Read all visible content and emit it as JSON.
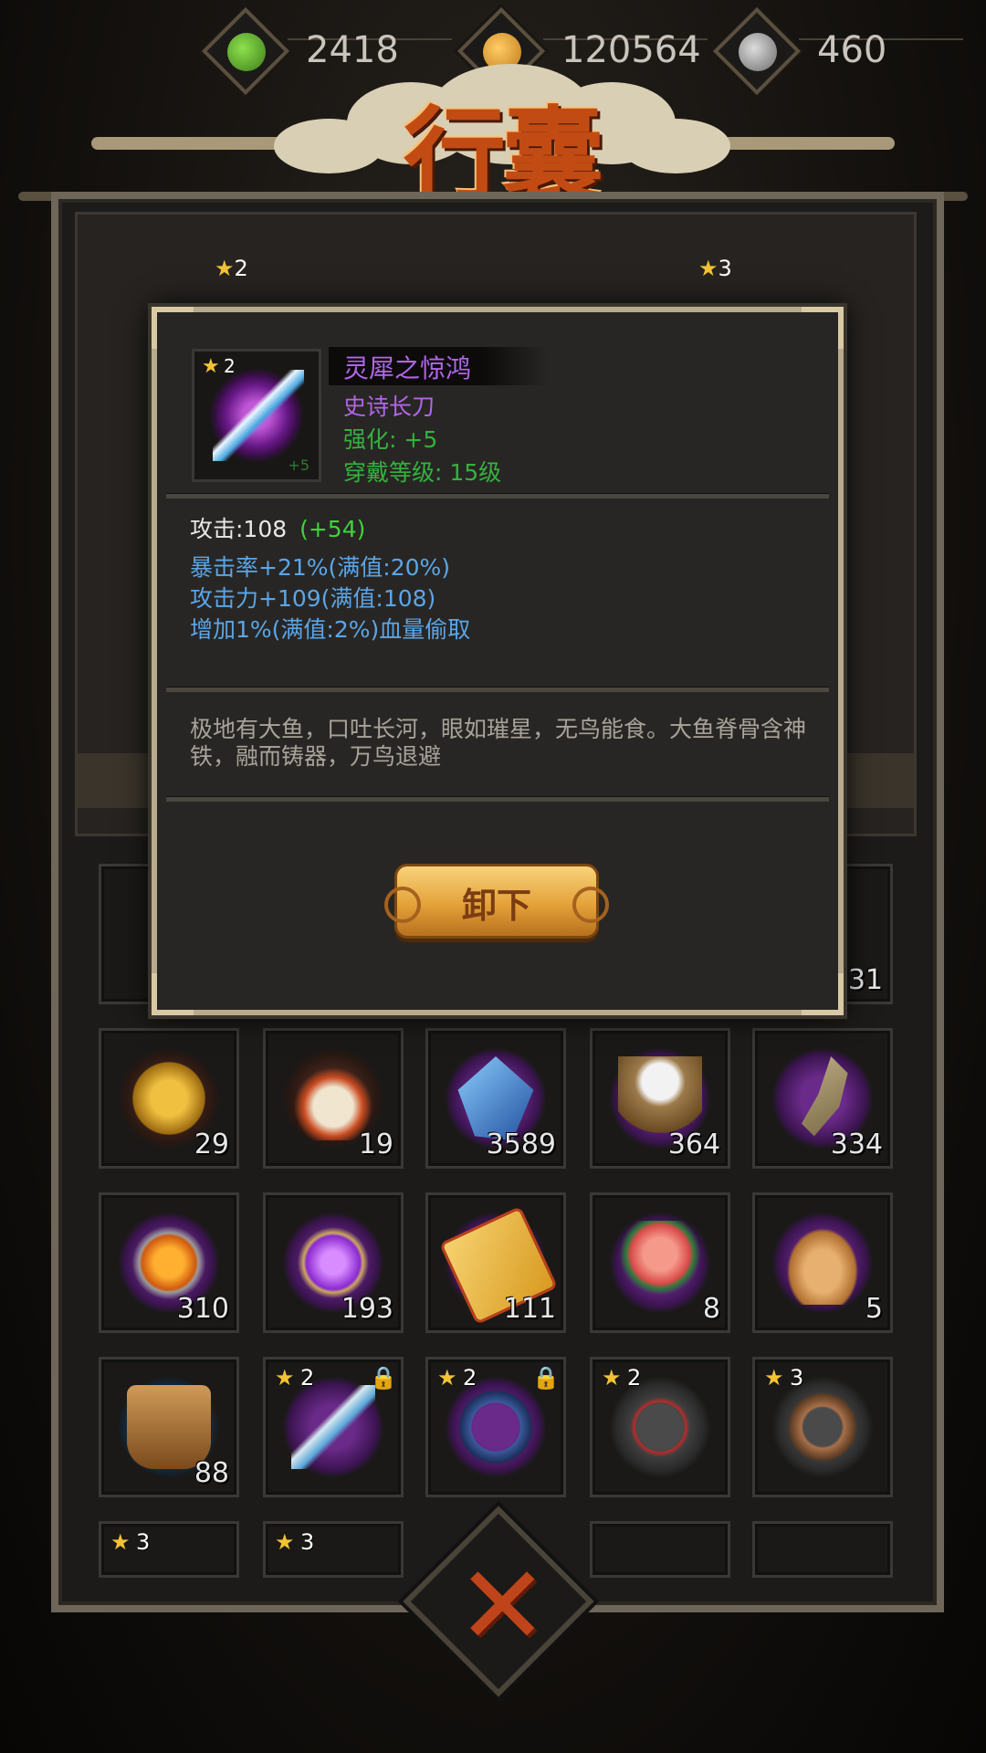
{
  "currency": {
    "jade": "2418",
    "coins": "120564",
    "yinyang": "460"
  },
  "title": "行囊",
  "popup": {
    "item_name": "灵犀之惊鸿",
    "item_type": "史诗长刀",
    "enhance": "强化: +5",
    "wear_level": "穿戴等级: 15级",
    "stars": "2",
    "plus_mark": "+5",
    "attack_label": "攻击:108",
    "attack_bonus": "(+54)",
    "stat_1": "暴击率+21%(满值:20%)",
    "stat_2": "攻击力+109(满值:108)",
    "stat_3": "增加1%(满值:2%)血量偷取",
    "description": "极地有大鱼，口吐长河，眼如璀星，无鸟能食。大鱼脊骨含神铁，融而铸器，万鸟退避",
    "unequip_button": "卸下"
  },
  "inventory": {
    "row1_last_count": "31",
    "row2": [
      {
        "name": "sun-emblem",
        "count": "29"
      },
      {
        "name": "crane-charm",
        "count": "19"
      },
      {
        "name": "blue-crystal",
        "count": "3589"
      },
      {
        "name": "rice-sack",
        "count": "364"
      },
      {
        "name": "fish",
        "count": "334"
      }
    ],
    "row3": [
      {
        "name": "fire-orb",
        "count": "310"
      },
      {
        "name": "purple-orb",
        "count": "193"
      },
      {
        "name": "scroll",
        "count": "111"
      },
      {
        "name": "peach",
        "count": "8"
      },
      {
        "name": "gourd-bottle",
        "count": "5"
      }
    ],
    "row4": [
      {
        "name": "wooden-bucket",
        "count": "88"
      },
      {
        "name": "blade",
        "stars": "2"
      },
      {
        "name": "belt",
        "stars": "2"
      },
      {
        "name": "necklace",
        "stars": "2"
      },
      {
        "name": "ring",
        "stars": "3"
      }
    ],
    "row5": [
      {
        "stars": "3"
      },
      {
        "stars": "3"
      }
    ],
    "top_slots_stars": [
      "2",
      "3"
    ]
  },
  "colors": {
    "item_name": "#b266e8",
    "item_type": "#b266e8",
    "green": "#35b13e",
    "blue_stat": "#5aa6e8",
    "attack_bonus": "#3ed33e"
  }
}
